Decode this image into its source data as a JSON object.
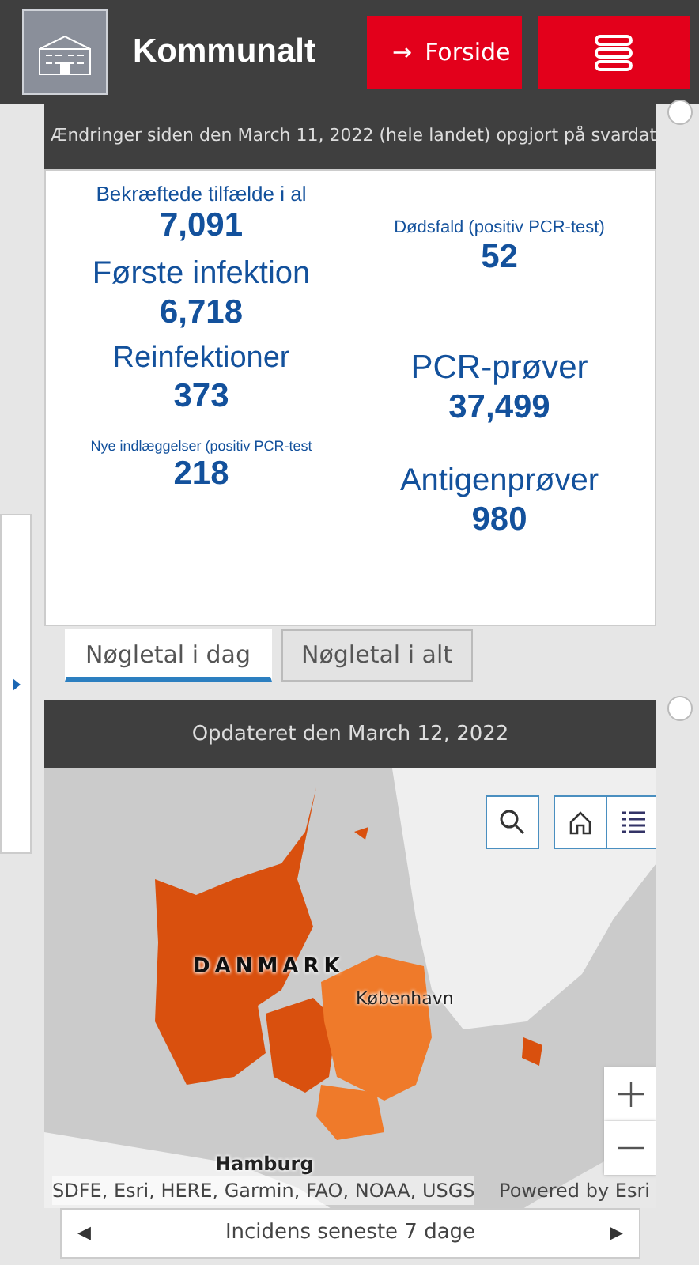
{
  "header": {
    "title": "Kommunalt",
    "home_button": {
      "arrow": "→",
      "label": "Forside"
    }
  },
  "stats_panel": {
    "title": "Ændringer siden den March 11, 2022 (hele landet) opgjort på svardat",
    "left": [
      {
        "label": "Bekræftede tilfælde i al",
        "value": "7,091"
      },
      {
        "label": "Første infektion",
        "value": "6,718"
      },
      {
        "label": "Reinfektioner",
        "value": "373"
      },
      {
        "label": "Nye indlæggelser (positiv PCR-test",
        "value": "218"
      }
    ],
    "right": [
      {
        "label": "Dødsfald (positiv PCR-test)",
        "value": "52"
      },
      {
        "label": "PCR-prøver",
        "value": "37,499"
      },
      {
        "label": "Antigenprøver",
        "value": "980"
      }
    ]
  },
  "tabs": [
    {
      "label": "Nøgletal i dag",
      "selected": true
    },
    {
      "label": "Nøgletal i alt",
      "selected": false
    }
  ],
  "map_panel": {
    "title": "Opdateret den March 12, 2022",
    "labels": {
      "country": "DANMARK",
      "city": "København",
      "city_2": "Hamburg"
    },
    "attribution": "SDFE, Esri, HERE, Garmin, FAO, NOAA, USGS",
    "powered_by": "Powered by Esri"
  },
  "layer_bar": {
    "prev": "◀",
    "label": "Incidens seneste 7 dage",
    "next": "▶"
  }
}
